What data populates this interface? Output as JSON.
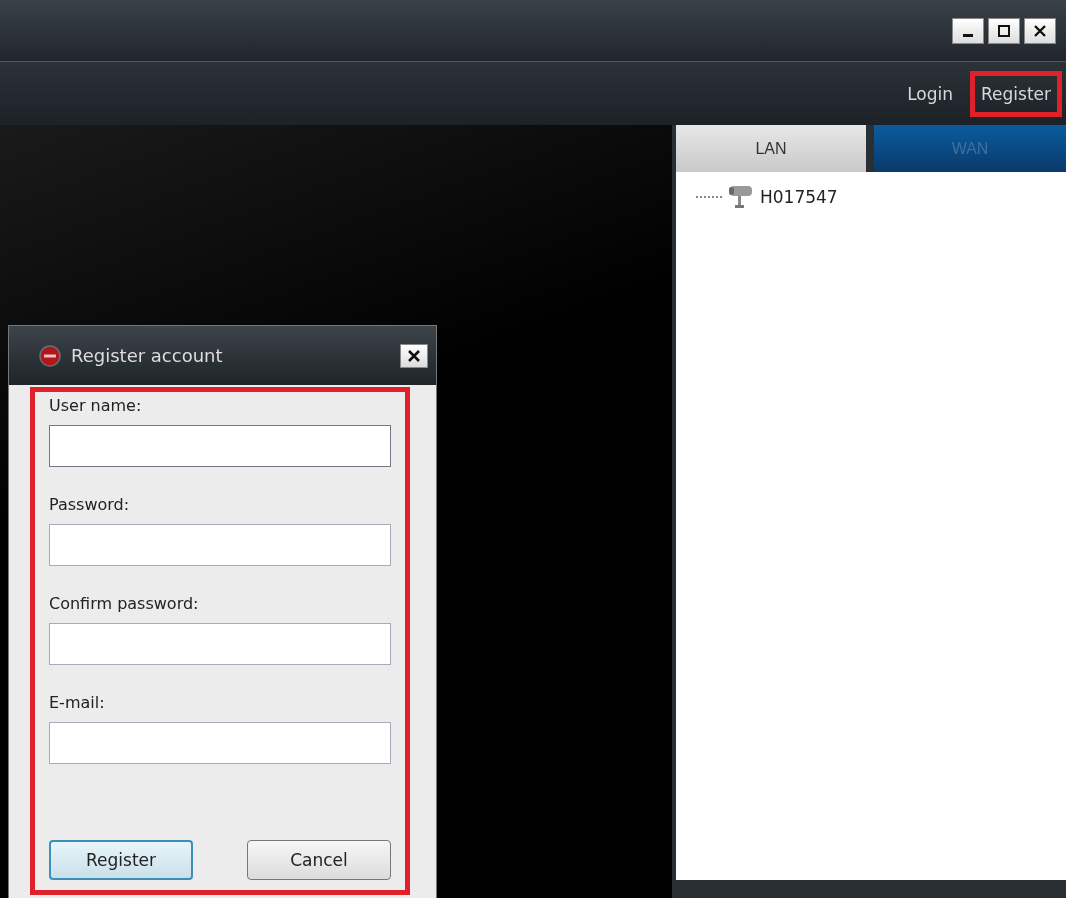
{
  "window": {
    "controls": [
      {
        "kind": "minimize"
      },
      {
        "kind": "maximize"
      },
      {
        "kind": "close"
      }
    ]
  },
  "account_links": [
    {
      "label": "Login",
      "highlighted": false
    },
    {
      "label": "Register",
      "highlighted": true
    }
  ],
  "tabs": [
    {
      "label": "LAN",
      "selected": true
    },
    {
      "label": "WAN",
      "selected": false
    }
  ],
  "devices": [
    {
      "name": "H017547"
    }
  ],
  "dialog": {
    "title": "Register account",
    "form_highlighted": true,
    "fields": [
      {
        "label": "User name:"
      },
      {
        "label": "Password:"
      },
      {
        "label": "Confirm password:"
      },
      {
        "label": "E-mail:"
      }
    ],
    "buttons": [
      {
        "label": "Register",
        "default": true
      },
      {
        "label": "Cancel",
        "default": false
      }
    ]
  }
}
